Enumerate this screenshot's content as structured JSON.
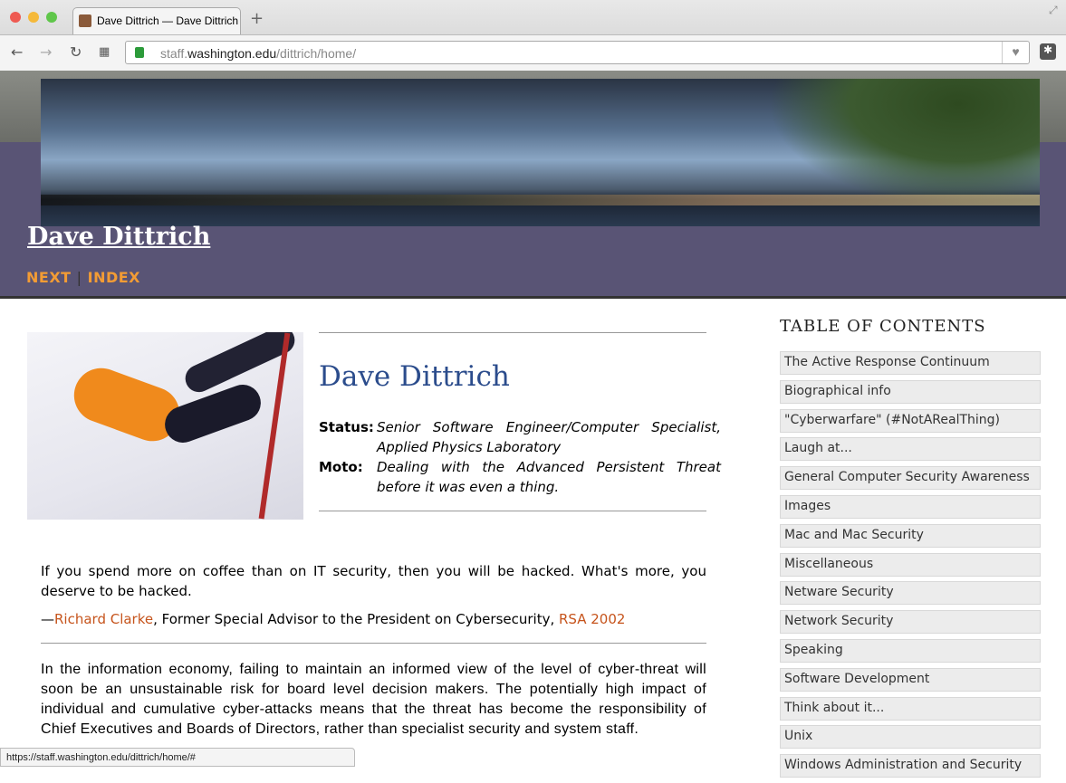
{
  "browser": {
    "tab_title": "Dave Dittrich — Dave Dittrich",
    "url_prefix": "staff.",
    "url_domain": "washington.edu",
    "url_path": "/dittrich/home/",
    "status_url": "https://staff.washington.edu/dittrich/home/#"
  },
  "header": {
    "title": "Dave Dittrich",
    "nav": {
      "next": "NEXT",
      "sep": "|",
      "index": "INDEX"
    }
  },
  "profile": {
    "name": "Dave Dittrich",
    "status_label": "Status:",
    "status_value": "Senior Software Engineer/Computer Specialist, Applied Physics Laboratory",
    "moto_label": "Moto:",
    "moto_value": "Dealing with the Advanced Persistent Threat before it was even a thing."
  },
  "quote": {
    "text": "If you spend more on coffee than on IT security, then you will be hacked. What's more, you deserve to be hacked.",
    "dash": "—",
    "author": "Richard Clarke",
    "role": ", Former Special Advisor to the President on Cybersecurity, ",
    "source": "RSA 2002"
  },
  "paragraph": "In the information economy, failing to maintain an informed view of the level of cyber-threat will soon be an unsustainable risk for board level decision makers. The potentially high impact of individual and cumulative cyber-attacks means that the threat has become the responsibility of Chief Executives and Boards of Directors, rather than specialist security and system staff.",
  "toc": {
    "heading": "TABLE OF CONTENTS",
    "items": [
      "The Active Response Continuum",
      "Biographical info",
      "\"Cyberwarfare\" (#NotARealThing)",
      "Laugh at...",
      "General Computer Security Awareness",
      "Images",
      "Mac and Mac Security",
      "Miscellaneous",
      "Netware Security",
      "Network Security",
      "Speaking",
      "Software Development",
      "Think about it...",
      "Unix",
      "Windows Administration and Security"
    ]
  }
}
